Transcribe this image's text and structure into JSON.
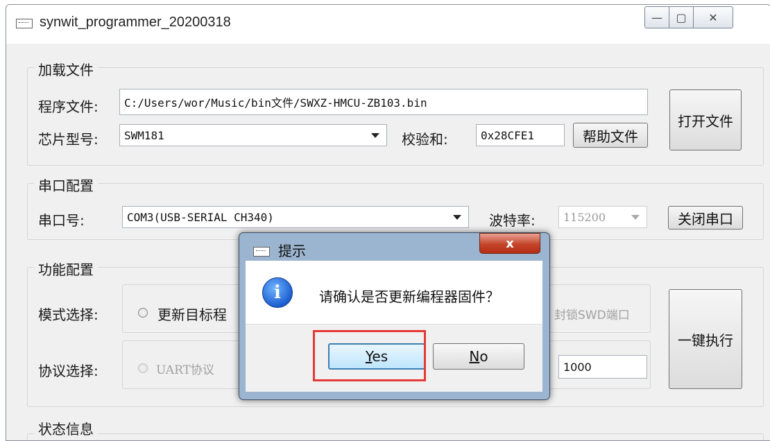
{
  "window": {
    "title": "synwit_programmer_20200318",
    "minimize_glyph": "—",
    "maximize_glyph": "▢",
    "close_glyph": "✕"
  },
  "load_file": {
    "group_title": "加载文件",
    "program_file_label": "程序文件:",
    "program_file_value": "C:/Users/wor/Music/bin文件/SWXZ-HMCU-ZB103.bin",
    "chip_model_label": "芯片型号:",
    "chip_model_value": "SWM181",
    "checksum_label": "校验和:",
    "checksum_value": "0x28CFE1",
    "help_button": "帮助文件",
    "open_button": "打开文件"
  },
  "serial": {
    "group_title": "串口配置",
    "port_label": "串口号:",
    "port_value": "COM3(USB-SERIAL CH340)",
    "baud_label": "波特率:",
    "baud_value": "115200",
    "close_button": "关闭串口"
  },
  "function": {
    "group_title": "功能配置",
    "mode_label": "模式选择:",
    "mode_option_1": "更新目标程",
    "mode_option_lock": "封锁SWD端口",
    "protocol_label": "协议选择:",
    "protocol_option_1": "UART协议",
    "value_field": "1000",
    "execute_button": "一键执行"
  },
  "status": {
    "group_title": "状态信息"
  },
  "dialog": {
    "title": "提示",
    "close_glyph": "x",
    "message": "请确认是否更新编程器固件？",
    "yes_mnemonic": "Y",
    "yes_rest": "es",
    "no_mnemonic": "N",
    "no_rest": "o",
    "icon_glyph": "i"
  },
  "colors": {
    "highlight_box": "#e53935",
    "dialog_frame": "#9bb4cf"
  }
}
